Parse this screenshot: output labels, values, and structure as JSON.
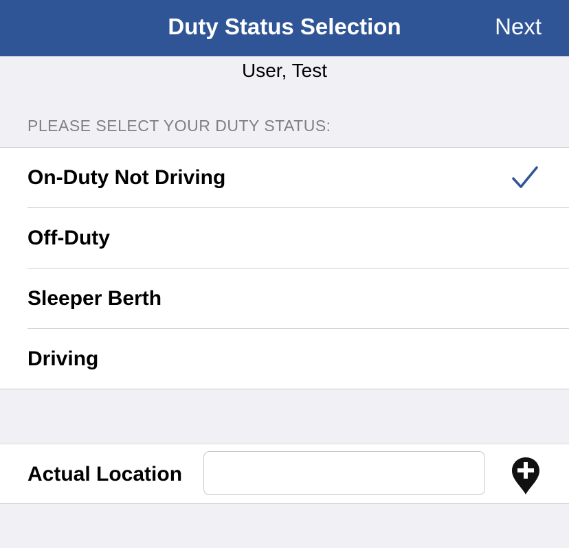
{
  "nav": {
    "title": "Duty Status Selection",
    "next_label": "Next",
    "background_color": "#2f5596"
  },
  "user": {
    "name": "User, Test"
  },
  "status_section": {
    "header": "PLEASE SELECT YOUR DUTY STATUS:",
    "items": [
      {
        "label": "On-Duty Not Driving",
        "selected": true
      },
      {
        "label": "Off-Duty",
        "selected": false
      },
      {
        "label": "Sleeper Berth",
        "selected": false
      },
      {
        "label": "Driving",
        "selected": false
      }
    ],
    "check_icon": "checkmark-icon",
    "check_color": "#2f5596"
  },
  "location": {
    "label": "Actual Location",
    "value": "",
    "placeholder": "",
    "add_icon": "map-pin-plus-icon"
  }
}
